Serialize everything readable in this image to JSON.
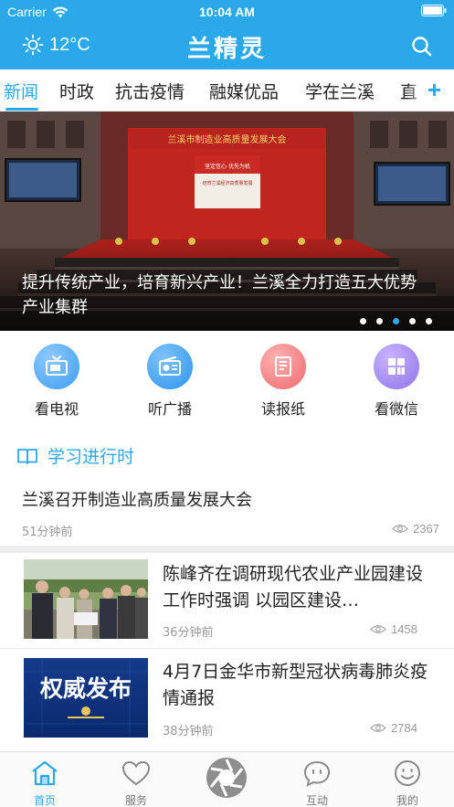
{
  "status_bar": {
    "carrier": "Carrier",
    "time": "10:04 AM"
  },
  "header": {
    "temperature": "12°C",
    "title": "兰精灵",
    "weather_icon": "sun-icon",
    "search_icon": "search-icon"
  },
  "tabs": [
    {
      "label": "新闻",
      "active": true
    },
    {
      "label": "时政"
    },
    {
      "label": "抗击疫情"
    },
    {
      "label": "融媒优品"
    },
    {
      "label": "学在兰溪"
    },
    {
      "label": "直"
    }
  ],
  "tab_add_label": "+",
  "banner": {
    "caption": "提升传统产业，培育新兴产业！兰溪全力打造五大优势产业集群",
    "stage_banner_text": "兰溪市制造业高质量发展大会",
    "screen_text_1": "坚定信心  优先为机",
    "screen_text_2": "培育兰溪经济高质量发展",
    "slide_count": 5,
    "active_slide": 3
  },
  "quick_entries": [
    {
      "label": "看电视",
      "icon": "tv-icon",
      "color": "#3f9ef0"
    },
    {
      "label": "听广播",
      "icon": "radio-icon",
      "color": "#2b95ec"
    },
    {
      "label": "读报纸",
      "icon": "newspaper-icon",
      "color": "#ee6b6e"
    },
    {
      "label": "看微信",
      "icon": "wechat-grid-icon",
      "color": "#8f72e6"
    }
  ],
  "study_section": {
    "title": "学习进行时",
    "icon": "book-icon",
    "article": {
      "title": "兰溪召开制造业高质量发展大会",
      "time": "51分钟前",
      "views": "2367"
    }
  },
  "news": [
    {
      "title": "陈峰齐在调研现代农业产业园建设工作时强调 以园区建设…",
      "time": "36分钟前",
      "views": "1458"
    },
    {
      "title": "4月7日金华市新型冠状病毒肺炎疫情通报",
      "time": "38分钟前",
      "views": "2784",
      "thumb_text": "权威发布"
    }
  ],
  "bottom_nav": [
    {
      "label": "首页",
      "icon": "home-icon",
      "active": true
    },
    {
      "label": "服务",
      "icon": "heart-icon"
    },
    {
      "label": "",
      "icon": "camera-aperture-icon"
    },
    {
      "label": "互动",
      "icon": "chat-bubble-icon"
    },
    {
      "label": "我的",
      "icon": "smiley-icon"
    }
  ],
  "colors": {
    "accent": "#2aa8ea",
    "text": "#222222",
    "muted": "#999999"
  }
}
